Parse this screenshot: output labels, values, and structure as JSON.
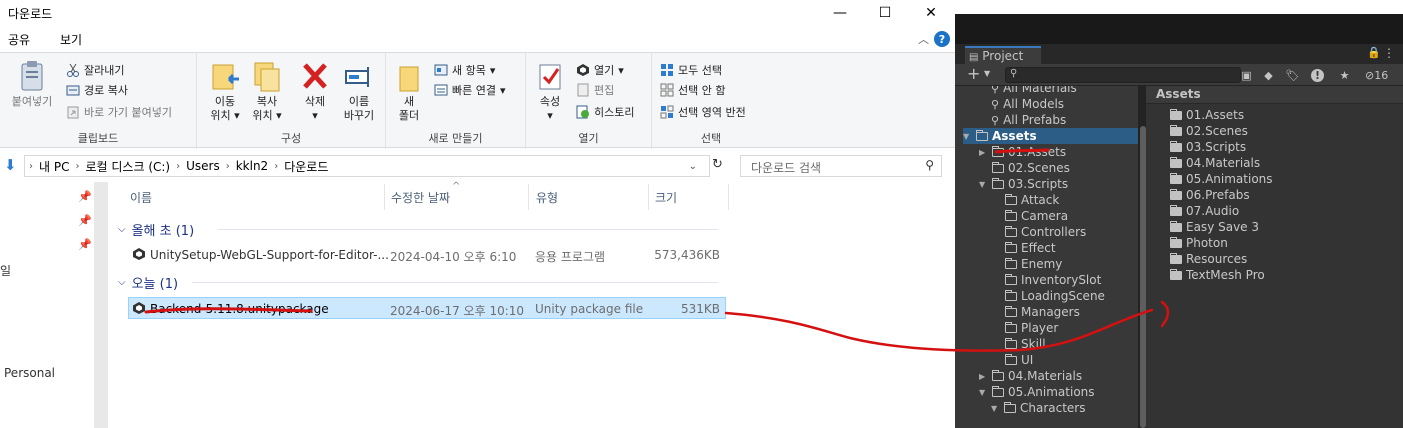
{
  "explorer": {
    "title": "다운로드",
    "window_buttons": {
      "minimize": "—",
      "maximize": "☐",
      "close": "✕"
    },
    "menu": [
      "공유",
      "보기"
    ],
    "ribbon": {
      "clipboard": {
        "label": "클립보드",
        "paste": "붙여넣기",
        "cut": "잘라내기",
        "copy_path": "경로 복사",
        "paste_shortcut": "바로 가기 붙여넣기"
      },
      "organize": {
        "label": "구성",
        "move_to": [
          "이동",
          "위치"
        ],
        "copy_to": [
          "복사",
          "위치"
        ],
        "delete": "삭제",
        "rename": [
          "이름",
          "바꾸기"
        ]
      },
      "new": {
        "label": "새로 만들기",
        "new_folder": [
          "새",
          "폴더"
        ],
        "new_item": "새 항목",
        "easy_access": "빠른 연결"
      },
      "open": {
        "label": "열기",
        "properties": "속성",
        "open": "열기",
        "edit": "편집",
        "history": "히스토리"
      },
      "select": {
        "label": "선택",
        "select_all": "모두 선택",
        "select_none": "선택 안 함",
        "invert": "선택 영역 반전"
      }
    },
    "address": [
      "내 PC",
      "로컬 디스크 (C:)",
      "Users",
      "kkln2",
      "다운로드"
    ],
    "search_placeholder": "다운로드 검색",
    "nav_partial": {
      "item1": "일",
      "item2": "Personal"
    },
    "columns": {
      "name": "이름",
      "modified": "수정한 날짜",
      "type": "유형",
      "size": "크기"
    },
    "groups": [
      {
        "title": "올해 초 (1)",
        "files": [
          {
            "name": "UnitySetup-WebGL-Support-for-Editor-...",
            "modified": "2024-04-10 오후 6:10",
            "type": "응용 프로그램",
            "size": "573,436KB"
          }
        ]
      },
      {
        "title": "오늘 (1)",
        "files": [
          {
            "name": "Backend-5.11.8.unitypackage",
            "modified": "2024-06-17 오후 10:10",
            "type": "Unity package file",
            "size": "531KB"
          }
        ]
      }
    ]
  },
  "unity": {
    "tab": "Project",
    "search_placeholder": "",
    "hidden_count": "16",
    "left_tree": [
      {
        "label": "All Materials",
        "kind": "search"
      },
      {
        "label": "All Models",
        "kind": "search"
      },
      {
        "label": "All Prefabs",
        "kind": "search"
      },
      {
        "label": "Assets",
        "kind": "root"
      },
      {
        "label": "01.Assets",
        "kind": "folder",
        "expand": "closed"
      },
      {
        "label": "02.Scenes",
        "kind": "folder",
        "expand": "none"
      },
      {
        "label": "03.Scripts",
        "kind": "folder",
        "expand": "open"
      },
      {
        "label": "Attack",
        "kind": "sub"
      },
      {
        "label": "Camera",
        "kind": "sub"
      },
      {
        "label": "Controllers",
        "kind": "sub"
      },
      {
        "label": "Effect",
        "kind": "sub"
      },
      {
        "label": "Enemy",
        "kind": "sub"
      },
      {
        "label": "InventorySlot",
        "kind": "sub"
      },
      {
        "label": "LoadingScene",
        "kind": "sub"
      },
      {
        "label": "Managers",
        "kind": "sub"
      },
      {
        "label": "Player",
        "kind": "sub"
      },
      {
        "label": "Skill",
        "kind": "sub"
      },
      {
        "label": "UI",
        "kind": "sub"
      },
      {
        "label": "04.Materials",
        "kind": "folder",
        "expand": "closed"
      },
      {
        "label": "05.Animations",
        "kind": "folder",
        "expand": "open"
      },
      {
        "label": "Characters",
        "kind": "sub2"
      }
    ],
    "breadcrumb": "Assets",
    "right_items": [
      "01.Assets",
      "02.Scenes",
      "03.Scripts",
      "04.Materials",
      "05.Animations",
      "06.Prefabs",
      "07.Audio",
      "Easy Save 3",
      "Photon",
      "Resources",
      "TextMesh Pro"
    ]
  },
  "colors": {
    "selection": "#cce8ff",
    "unity_bg": "#383838",
    "unity_highlight": "#2c5d87",
    "annotation": "#d41010"
  }
}
